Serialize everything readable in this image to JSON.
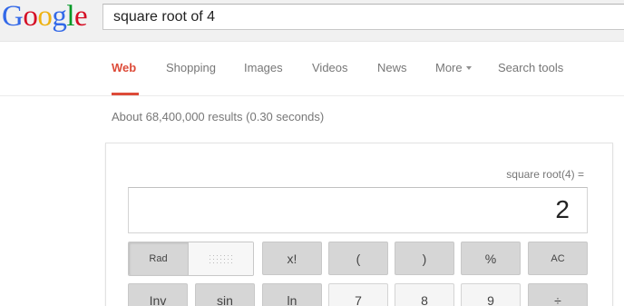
{
  "logo": {
    "letters": [
      "G",
      "o",
      "o",
      "g",
      "l",
      "e"
    ],
    "colors": [
      "#3369e8",
      "#d50f25",
      "#eeb211",
      "#3369e8",
      "#009925",
      "#d50f25"
    ]
  },
  "search": {
    "query": "square root of 4"
  },
  "nav": {
    "tabs": [
      {
        "label": "Web",
        "active": true
      },
      {
        "label": "Shopping"
      },
      {
        "label": "Images"
      },
      {
        "label": "Videos"
      },
      {
        "label": "News"
      },
      {
        "label": "More"
      },
      {
        "label": "Search tools"
      }
    ],
    "active_color": "#dd4b39"
  },
  "results": {
    "stats": "About 68,400,000 results (0.30 seconds)"
  },
  "calculator": {
    "expression": "square root(4) =",
    "result": "2",
    "mode": {
      "rad": "Rad"
    },
    "row1": [
      "x!",
      "(",
      ")",
      "%",
      "AC"
    ],
    "row2": [
      "Inv",
      "sin",
      "ln",
      "7",
      "8",
      "9",
      "÷"
    ]
  }
}
